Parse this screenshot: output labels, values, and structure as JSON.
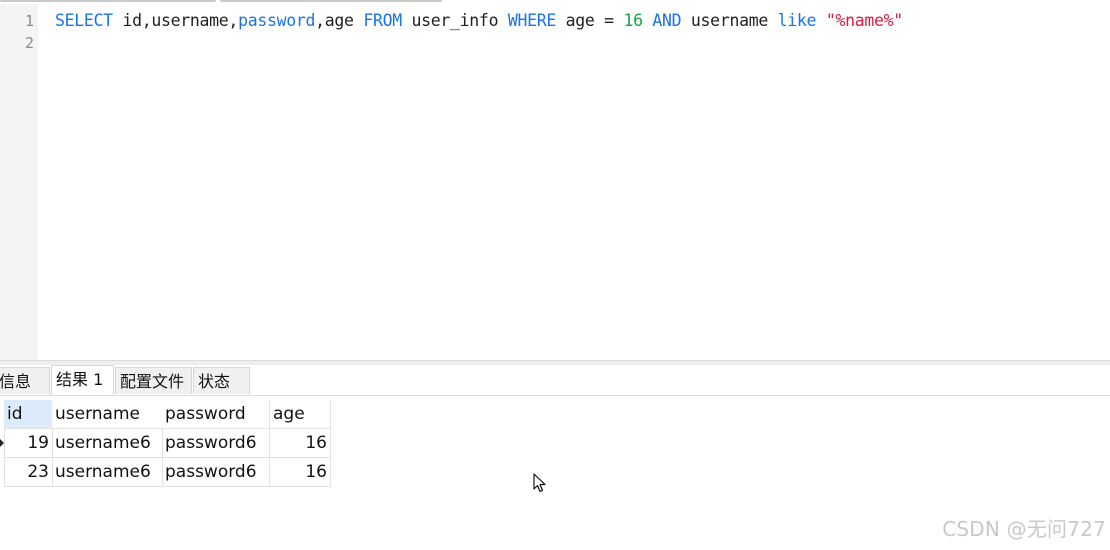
{
  "editor": {
    "line_numbers": [
      "1",
      "2"
    ],
    "sql": {
      "kw_select": "SELECT",
      "cols": " id,username,",
      "kw_password": "password",
      "cols2": ",age ",
      "kw_from": "FROM",
      "table": " user_info ",
      "kw_where": "WHERE",
      "cond1": " age = ",
      "num16": "16",
      "space1": " ",
      "kw_and": "AND",
      "cond2": " username ",
      "kw_like": "like",
      "space2": " ",
      "str": "\"%name%\""
    }
  },
  "result_tabs": [
    {
      "label": "信息"
    },
    {
      "label": "结果 1",
      "active": true
    },
    {
      "label": "配置文件"
    },
    {
      "label": "状态"
    }
  ],
  "table": {
    "columns": [
      "id",
      "username",
      "password",
      "age"
    ],
    "rows": [
      [
        "19",
        "username6",
        "password6",
        "16"
      ],
      [
        "23",
        "username6",
        "password6",
        "16"
      ]
    ]
  },
  "watermark": "CSDN @无问727",
  "colors": {
    "keyword": "#1a73e8",
    "number": "#1aa34a",
    "string": "#d81b3f",
    "selected_header": "#dcebfb"
  },
  "icons": {
    "row_indicator": "row-indicator-icon",
    "cursor": "mouse-pointer-icon"
  }
}
